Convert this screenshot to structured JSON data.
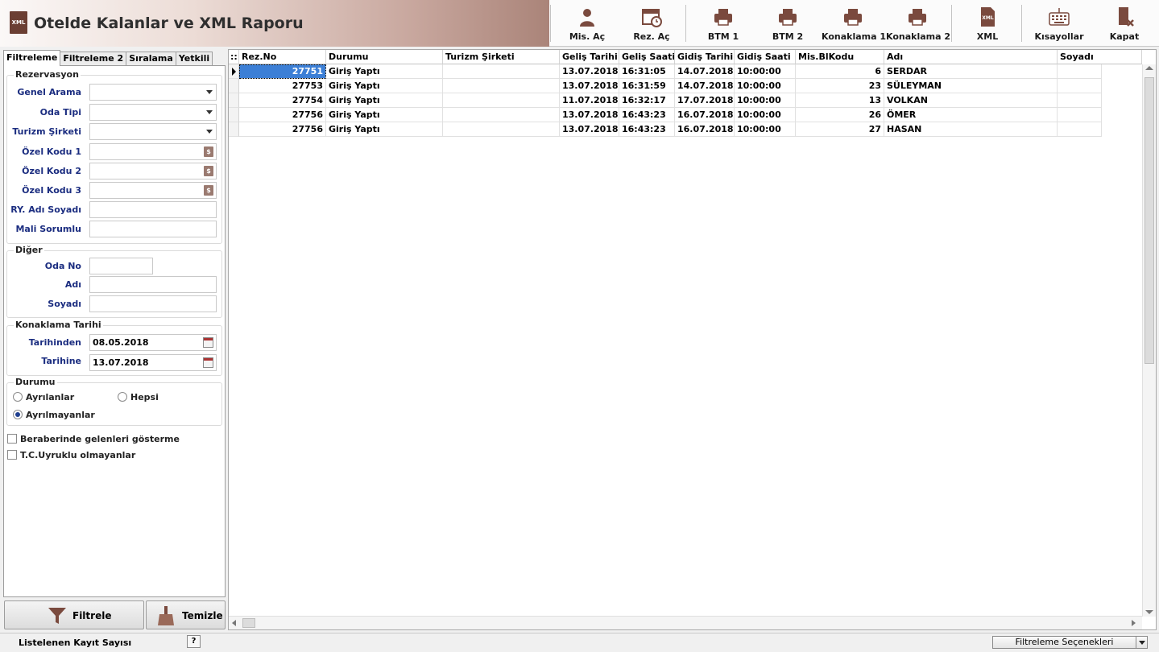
{
  "title": "Otelde Kalanlar ve XML Raporu",
  "toolbar": {
    "mis_ac": "Mis. Aç",
    "rez_ac": "Rez. Aç",
    "btm1": "BTM 1",
    "btm2": "BTM 2",
    "konaklama1": "Konaklama 1",
    "konaklama2": "Konaklama 2",
    "xml": "XML",
    "kisayollar": "Kısayollar",
    "kapat": "Kapat"
  },
  "tabs": [
    "Filtreleme",
    "Filtreleme 2",
    "Sıralama",
    "Yetkili"
  ],
  "rezervasyon": {
    "title": "Rezervasyon",
    "genel_arama": "Genel Arama",
    "oda_tipi": "Oda Tipi",
    "turizm_sirketi": "Turizm Şirketi",
    "ozel_kodu_1": "Özel Kodu 1",
    "ozel_kodu_2": "Özel Kodu 2",
    "ozel_kodu_3": "Özel Kodu 3",
    "ry_adi_soyadi": "RY. Adı Soyadı",
    "mali_sorumlu": "Mali Sorumlu"
  },
  "diger": {
    "title": "Diğer",
    "oda_no": "Oda No",
    "adi": "Adı",
    "soyadi": "Soyadı"
  },
  "konaklama": {
    "title": "Konaklama Tarihi",
    "tarihinden_label": "Tarihinden",
    "tarihinden_value": "08.05.2018",
    "tarihine_label": "Tarihine",
    "tarihine_value": "13.07.2018"
  },
  "durumu": {
    "title": "Durumu",
    "ayrilanlar": "Ayrılanlar",
    "hepsi": "Hepsi",
    "ayrilmayanlar": "Ayrılmayanlar"
  },
  "checks": {
    "beraberinde": "Beraberinde gelenleri gösterme",
    "tc_uyruklu": "T.C.Uyruklu olmayanlar"
  },
  "buttons": {
    "filtrele": "Filtrele",
    "temizle": "Temizle"
  },
  "grid": {
    "indicator": "::",
    "columns": [
      "Rez.No",
      "Durumu",
      "Turizm Şirketi",
      "Geliş Tarihi",
      "Geliş Saati",
      "Gidiş Tarihi",
      "Gidiş Saati",
      "Mis.BlKodu",
      "Adı",
      "Soyadı"
    ],
    "rows": [
      [
        "27751",
        "Giriş Yaptı",
        "",
        "13.07.2018",
        "16:31:05",
        "14.07.2018",
        "10:00:00",
        "6",
        "SERDAR",
        ""
      ],
      [
        "27753",
        "Giriş Yaptı",
        "",
        "13.07.2018",
        "16:31:59",
        "14.07.2018",
        "10:00:00",
        "23",
        "SÜLEYMAN",
        ""
      ],
      [
        "27754",
        "Giriş Yaptı",
        "",
        "11.07.2018",
        "16:32:17",
        "17.07.2018",
        "10:00:00",
        "13",
        "VOLKAN",
        ""
      ],
      [
        "27756",
        "Giriş Yaptı",
        "",
        "13.07.2018",
        "16:43:23",
        "16.07.2018",
        "10:00:00",
        "26",
        "ÖMER",
        ""
      ],
      [
        "27756",
        "Giriş Yaptı",
        "",
        "13.07.2018",
        "16:43:23",
        "16.07.2018",
        "10:00:00",
        "27",
        "HASAN",
        ""
      ]
    ]
  },
  "status": {
    "kayit_sayisi": "Listelenen Kayıt Sayısı",
    "help": "?",
    "filtre_secenekleri": "Filtreleme Seçenekleri"
  },
  "colors": {
    "accent": "#aa8479",
    "label": "#1b2d80",
    "selected": "#3c7fd6"
  }
}
